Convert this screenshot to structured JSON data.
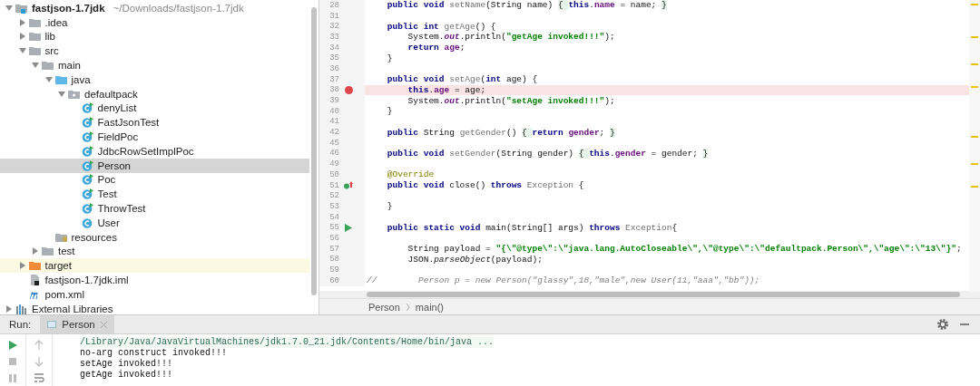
{
  "project_tree": {
    "items": [
      {
        "label": "fastjson-1.7jdk",
        "path": "~/Downloads/fastjson-1.7jdk",
        "kind": "project",
        "expanded": true,
        "selected": false,
        "children": [
          {
            "label": ".idea",
            "kind": "folder",
            "expanded": false,
            "selected": false
          },
          {
            "label": "lib",
            "kind": "folder",
            "expanded": false,
            "selected": false
          },
          {
            "label": "src",
            "kind": "folder",
            "expanded": true,
            "selected": false,
            "children": [
              {
                "label": "main",
                "kind": "folder",
                "expanded": true,
                "selected": false,
                "children": [
                  {
                    "label": "java",
                    "kind": "source-folder",
                    "expanded": true,
                    "selected": false,
                    "children": [
                      {
                        "label": "defaultpack",
                        "kind": "package",
                        "expanded": true,
                        "selected": false,
                        "children": [
                          {
                            "label": "denyList",
                            "kind": "class",
                            "runnable": true,
                            "selected": false
                          },
                          {
                            "label": "FastJsonTest",
                            "kind": "class",
                            "runnable": true,
                            "selected": false
                          },
                          {
                            "label": "FieldPoc",
                            "kind": "class",
                            "runnable": true,
                            "selected": false
                          },
                          {
                            "label": "JdbcRowSetImplPoc",
                            "kind": "class",
                            "runnable": true,
                            "selected": false
                          },
                          {
                            "label": "Person",
                            "kind": "class",
                            "runnable": true,
                            "selected": true
                          },
                          {
                            "label": "Poc",
                            "kind": "class",
                            "runnable": true,
                            "selected": false
                          },
                          {
                            "label": "Test",
                            "kind": "class",
                            "runnable": true,
                            "selected": false
                          },
                          {
                            "label": "ThrowTest",
                            "kind": "class",
                            "runnable": true,
                            "selected": false
                          },
                          {
                            "label": "User",
                            "kind": "class",
                            "runnable": false,
                            "selected": false
                          }
                        ]
                      }
                    ]
                  },
                  {
                    "label": "resources",
                    "kind": "resources",
                    "selected": false
                  }
                ]
              },
              {
                "label": "test",
                "kind": "folder",
                "expanded": false,
                "selected": false
              }
            ]
          },
          {
            "label": "target",
            "kind": "excluded-folder",
            "expanded": false,
            "selected": false
          },
          {
            "label": "fastjson-1.7jdk.iml",
            "kind": "module-file",
            "selected": false
          },
          {
            "label": "pom.xml",
            "kind": "maven-file",
            "selected": false
          }
        ]
      },
      {
        "label": "External Libraries",
        "kind": "library",
        "expanded": false,
        "selected": false
      }
    ]
  },
  "editor": {
    "lines": [
      {
        "number": "28",
        "tokens": [
          {
            "kind": "kw",
            "text": "    public void "
          },
          {
            "kind": "decl",
            "text": "setName"
          },
          {
            "kind": "p",
            "text": "(String name) "
          },
          {
            "kind": "fold",
            "text": "{ "
          },
          {
            "kind": "kw",
            "text": "this"
          },
          {
            "kind": "p",
            "text": "."
          },
          {
            "kind": "field",
            "text": "name"
          },
          {
            "kind": "p",
            "text": " = name; "
          },
          {
            "kind": "fold",
            "text": "}"
          }
        ]
      },
      {
        "number": "31"
      },
      {
        "number": "32",
        "tokens": [
          {
            "kind": "kw",
            "text": "    public int "
          },
          {
            "kind": "decl",
            "text": "getAge"
          },
          {
            "kind": "p",
            "text": "() {"
          }
        ]
      },
      {
        "number": "33",
        "tokens": [
          {
            "kind": "p",
            "text": "        System."
          },
          {
            "kind": "static",
            "text": "out"
          },
          {
            "kind": "p",
            "text": ".println("
          },
          {
            "kind": "str",
            "text": "\"getAge invoked!!!\""
          },
          {
            "kind": "p",
            "text": ");"
          }
        ]
      },
      {
        "number": "34",
        "tokens": [
          {
            "kind": "kw",
            "text": "        return "
          },
          {
            "kind": "field",
            "text": "age"
          },
          {
            "kind": "p",
            "text": ";"
          }
        ]
      },
      {
        "number": "35",
        "tokens": [
          {
            "kind": "p",
            "text": "    }"
          }
        ]
      },
      {
        "number": "36"
      },
      {
        "number": "37",
        "tokens": [
          {
            "kind": "kw",
            "text": "    public void "
          },
          {
            "kind": "decl",
            "text": "setAge"
          },
          {
            "kind": "p",
            "text": "("
          },
          {
            "kind": "kw",
            "text": "int"
          },
          {
            "kind": "p",
            "text": " age) {"
          }
        ]
      },
      {
        "number": "38",
        "kind": "breakpoint",
        "highlighted": true,
        "tokens": [
          {
            "kind": "kw",
            "text": "        this"
          },
          {
            "kind": "p",
            "text": "."
          },
          {
            "kind": "field",
            "text": "age"
          },
          {
            "kind": "p",
            "text": " = age;"
          }
        ]
      },
      {
        "number": "39",
        "tokens": [
          {
            "kind": "p",
            "text": "        System."
          },
          {
            "kind": "static",
            "text": "out"
          },
          {
            "kind": "p",
            "text": ".println("
          },
          {
            "kind": "str",
            "text": "\"setAge invoked!!!\""
          },
          {
            "kind": "p",
            "text": ");"
          }
        ]
      },
      {
        "number": "40",
        "tokens": [
          {
            "kind": "p",
            "text": "    }"
          }
        ]
      },
      {
        "number": "41"
      },
      {
        "number": "42",
        "tokens": [
          {
            "kind": "kw",
            "text": "    public "
          },
          {
            "kind": "p",
            "text": "String "
          },
          {
            "kind": "decl",
            "text": "getGender"
          },
          {
            "kind": "p",
            "text": "() "
          },
          {
            "kind": "fold",
            "text": "{ "
          },
          {
            "kind": "kw",
            "text": "return "
          },
          {
            "kind": "field",
            "text": "gender"
          },
          {
            "kind": "p",
            "text": "; "
          },
          {
            "kind": "fold",
            "text": "}"
          }
        ]
      },
      {
        "number": "45"
      },
      {
        "number": "46",
        "tokens": [
          {
            "kind": "kw",
            "text": "    public void "
          },
          {
            "kind": "decl",
            "text": "setGender"
          },
          {
            "kind": "p",
            "text": "(String gender) "
          },
          {
            "kind": "fold",
            "text": "{ "
          },
          {
            "kind": "kw",
            "text": "this"
          },
          {
            "kind": "p",
            "text": "."
          },
          {
            "kind": "field",
            "text": "gender"
          },
          {
            "kind": "p",
            "text": " = gender; "
          },
          {
            "kind": "fold",
            "text": "}"
          }
        ]
      },
      {
        "number": "49"
      },
      {
        "number": "50",
        "tokens": [
          {
            "kind": "ann",
            "text": "    @Override"
          }
        ]
      },
      {
        "number": "51",
        "kind": "override",
        "tokens": [
          {
            "kind": "kw",
            "text": "    public void "
          },
          {
            "kind": "p",
            "text": "close() "
          },
          {
            "kind": "kw",
            "text": "throws "
          },
          {
            "kind": "decl",
            "text": "Exception"
          },
          {
            "kind": "p",
            "text": " {"
          }
        ]
      },
      {
        "number": "52"
      },
      {
        "number": "53",
        "tokens": [
          {
            "kind": "p",
            "text": "    }"
          }
        ]
      },
      {
        "number": "54"
      },
      {
        "number": "55",
        "kind": "run",
        "tokens": [
          {
            "kind": "kw",
            "text": "    public static void "
          },
          {
            "kind": "p",
            "text": "main(String[] args) "
          },
          {
            "kind": "kw",
            "text": "throws "
          },
          {
            "kind": "decl",
            "text": "Exception"
          },
          {
            "kind": "p",
            "text": "{"
          }
        ]
      },
      {
        "number": "56"
      },
      {
        "number": "57",
        "tokens": [
          {
            "kind": "p",
            "text": "        String payload = "
          },
          {
            "kind": "str",
            "text": "\"{\\\"@type\\\":\\\"java.lang.AutoCloseable\\\",\\\"@type\\\":\\\"defaultpack.Person\\\",\\\"age\\\":\\\"13\\\"}\""
          },
          {
            "kind": "p",
            "text": ";"
          }
        ]
      },
      {
        "number": "58",
        "tokens": [
          {
            "kind": "p",
            "text": "        JSON."
          },
          {
            "kind": "static-call",
            "text": "parseObject"
          },
          {
            "kind": "p",
            "text": "(payload);"
          }
        ]
      },
      {
        "number": "59"
      },
      {
        "number": "60",
        "tokens": [
          {
            "kind": "comment",
            "text": "//        Person p = new Person(\"glassy\",18,\"male\",new User(11,\"aaa\",\"bb\"));"
          }
        ]
      }
    ],
    "breadcrumbs": [
      "Person",
      "main()"
    ]
  },
  "run_panel": {
    "label": "Run:",
    "tabs": [
      {
        "label": "Person",
        "selected": true
      }
    ],
    "output": [
      {
        "kind": "command",
        "text": "/Library/Java/JavaVirtualMachines/jdk1.7.0_21.jdk/Contents/Home/bin/java ..."
      },
      {
        "kind": "stdout",
        "text": "no-arg construct invoked!!!"
      },
      {
        "kind": "stdout",
        "text": "setAge invoked!!!"
      },
      {
        "kind": "stdout",
        "text": "getAge invoked!!!"
      }
    ]
  }
}
